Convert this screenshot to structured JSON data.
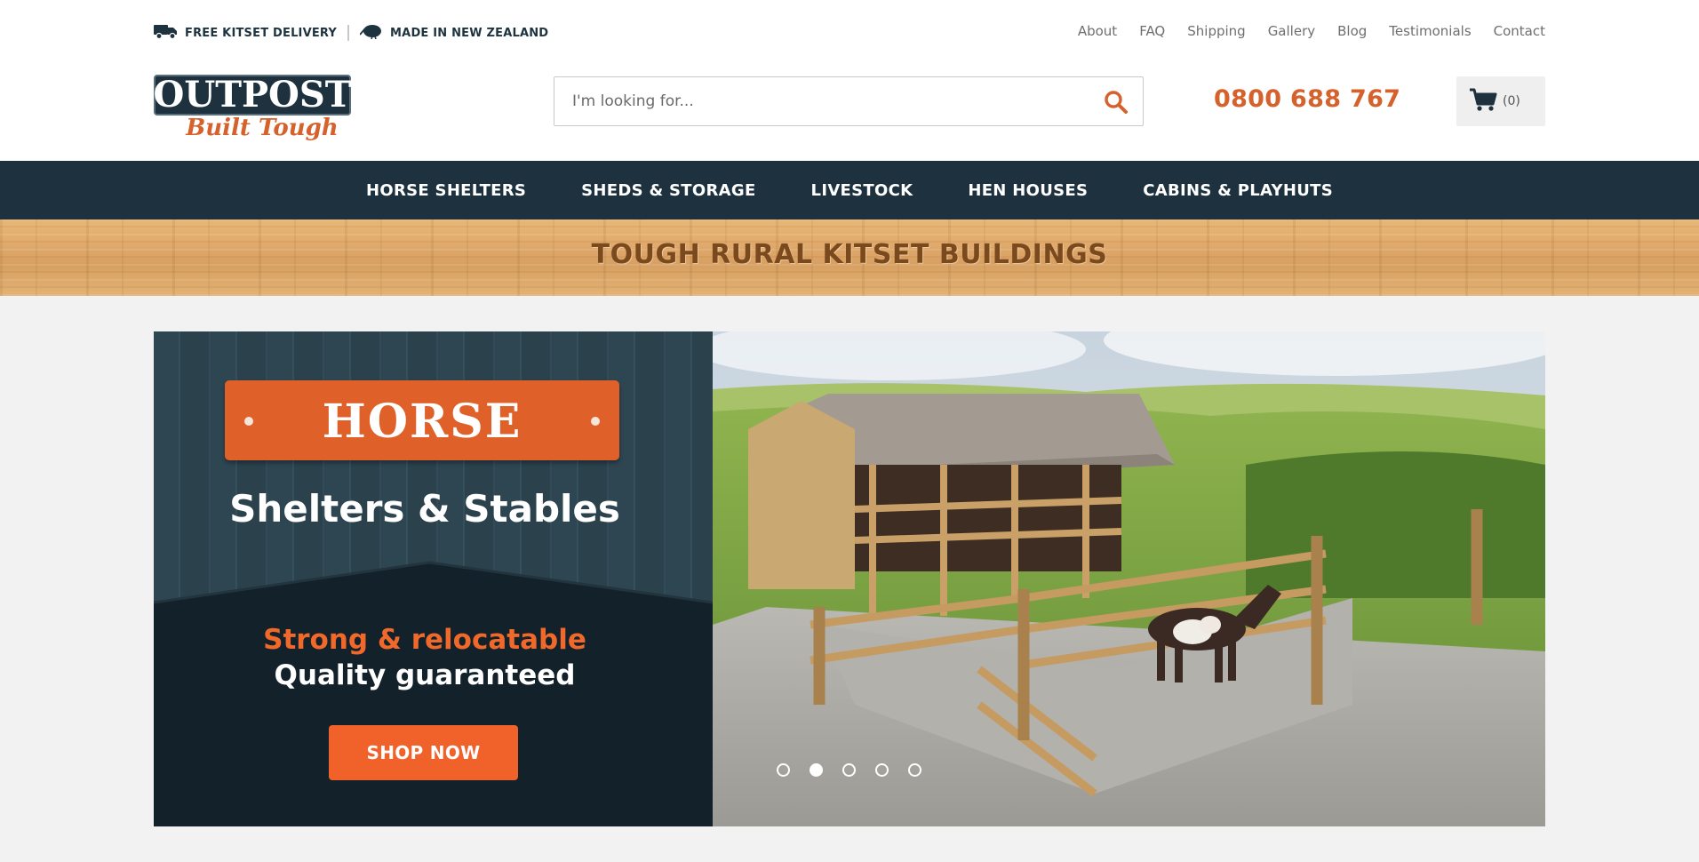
{
  "topbar": {
    "delivery_label": "FREE KITSET DELIVERY",
    "nz_label": "MADE IN NEW ZEALAND",
    "links": [
      "About",
      "FAQ",
      "Shipping",
      "Gallery",
      "Blog",
      "Testimonials",
      "Contact"
    ]
  },
  "logo": {
    "main": "OUTPOST",
    "tagline": "Built Tough"
  },
  "search": {
    "placeholder": "I'm looking for...",
    "value": ""
  },
  "phone": "0800 688 767",
  "cart": {
    "count": "(0)"
  },
  "mainnav": [
    "HORSE SHELTERS",
    "SHEDS & STORAGE",
    "LIVESTOCK",
    "HEN HOUSES",
    "CABINS & PLAYHUTS"
  ],
  "banner": {
    "title": "TOUGH RURAL KITSET BUILDINGS"
  },
  "slide": {
    "sign": "HORSE",
    "headline": "Shelters & Stables",
    "line1": "Strong & relocatable",
    "line2": "Quality guaranteed",
    "cta": "SHOP NOW"
  },
  "slider_dots": {
    "count": 5,
    "active_index": 2
  },
  "colors": {
    "navy": "#1d323e",
    "orange": "#d5612c",
    "cta_orange": "#f0622a",
    "background": "#f2f2f2"
  }
}
